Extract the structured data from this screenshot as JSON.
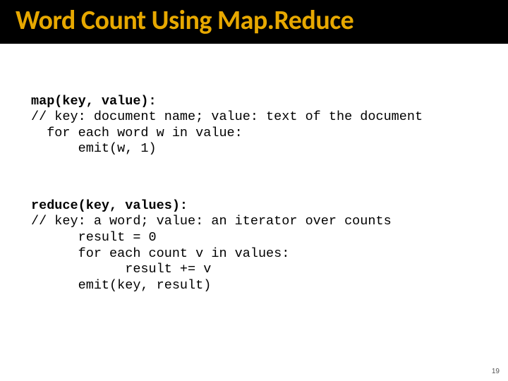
{
  "title": "Word Count Using Map.Reduce",
  "map": {
    "sig": "map(key, value):",
    "comment": "// key: document name; value: text of the document",
    "l1": "  for each word w in value:",
    "l2": "      emit(w, 1)"
  },
  "reduce": {
    "sig": "reduce(key, values):",
    "comment": "// key: a word; value: an iterator over counts",
    "l1": "      result = 0",
    "l2": "      for each count v in values:",
    "l3": "            result += v",
    "l4": "      emit(key, result)"
  },
  "page_number": "19"
}
